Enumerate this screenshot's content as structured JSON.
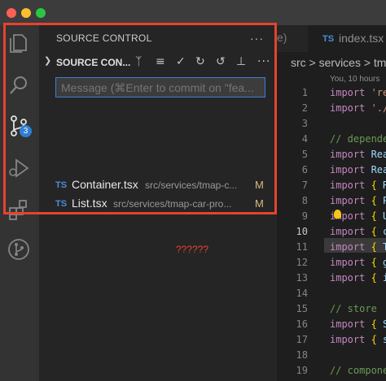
{
  "window": {
    "traffic_lights": {
      "close": "#ff5f57",
      "minimize": "#febc2e",
      "maximize": "#28c840"
    }
  },
  "activity_bar": {
    "items": [
      {
        "name": "explorer",
        "icon": "files-icon"
      },
      {
        "name": "search",
        "icon": "search-icon"
      },
      {
        "name": "source-control",
        "icon": "source-control-icon",
        "badge": "3"
      },
      {
        "name": "run-debug",
        "icon": "run-debug-icon"
      },
      {
        "name": "extensions",
        "icon": "extensions-icon"
      },
      {
        "name": "git-graph",
        "icon": "git-graph-icon"
      }
    ]
  },
  "source_control": {
    "panel_title": "SOURCE CONTROL",
    "more_label": "···",
    "section_title": "SOURCE CON...",
    "toolbar": [
      "branch-icon",
      "list-icon",
      "check-icon",
      "refresh-icon",
      "history-icon",
      "graph-icon",
      "more-icon"
    ],
    "more_glyph": "···",
    "commit_placeholder": "Message (⌘Enter to commit on \"fea...",
    "changes": [
      {
        "lang": "TS",
        "name": "Container.tsx",
        "path": "src/services/tmap-c...",
        "status": "M"
      },
      {
        "lang": "TS",
        "name": "List.tsx",
        "path": "src/services/tmap-car-pro...",
        "status": "M"
      }
    ]
  },
  "annotation": {
    "text": "??????",
    "color": "#e8422c"
  },
  "editor": {
    "tab_partial": "e)",
    "tab_lang": "TS",
    "tab_name": "index.tsx",
    "breadcrumb": "src > services > tm",
    "blame": "You, 10 hours",
    "lines": [
      {
        "n": "1",
        "code": "import 'rea"
      },
      {
        "n": "2",
        "code": "import './s"
      },
      {
        "n": "3",
        "code": ""
      },
      {
        "n": "4",
        "code": "// depende"
      },
      {
        "n": "5",
        "code": "import Reac"
      },
      {
        "n": "6",
        "code": "import Reac"
      },
      {
        "n": "7",
        "code": "import { Ro"
      },
      {
        "n": "8",
        "code": "import { Pr"
      },
      {
        "n": "9",
        "code": "import { UA"
      },
      {
        "n": "10",
        "code": "import { cr"
      },
      {
        "n": "11",
        "code": "import { Tm"
      },
      {
        "n": "12",
        "code": "import { ge"
      },
      {
        "n": "13",
        "code": "import { in"
      },
      {
        "n": "14",
        "code": ""
      },
      {
        "n": "15",
        "code": "// store"
      },
      {
        "n": "16",
        "code": "import { ST"
      },
      {
        "n": "17",
        "code": "import { se"
      },
      {
        "n": "18",
        "code": ""
      },
      {
        "n": "19",
        "code": "// componen"
      }
    ]
  }
}
